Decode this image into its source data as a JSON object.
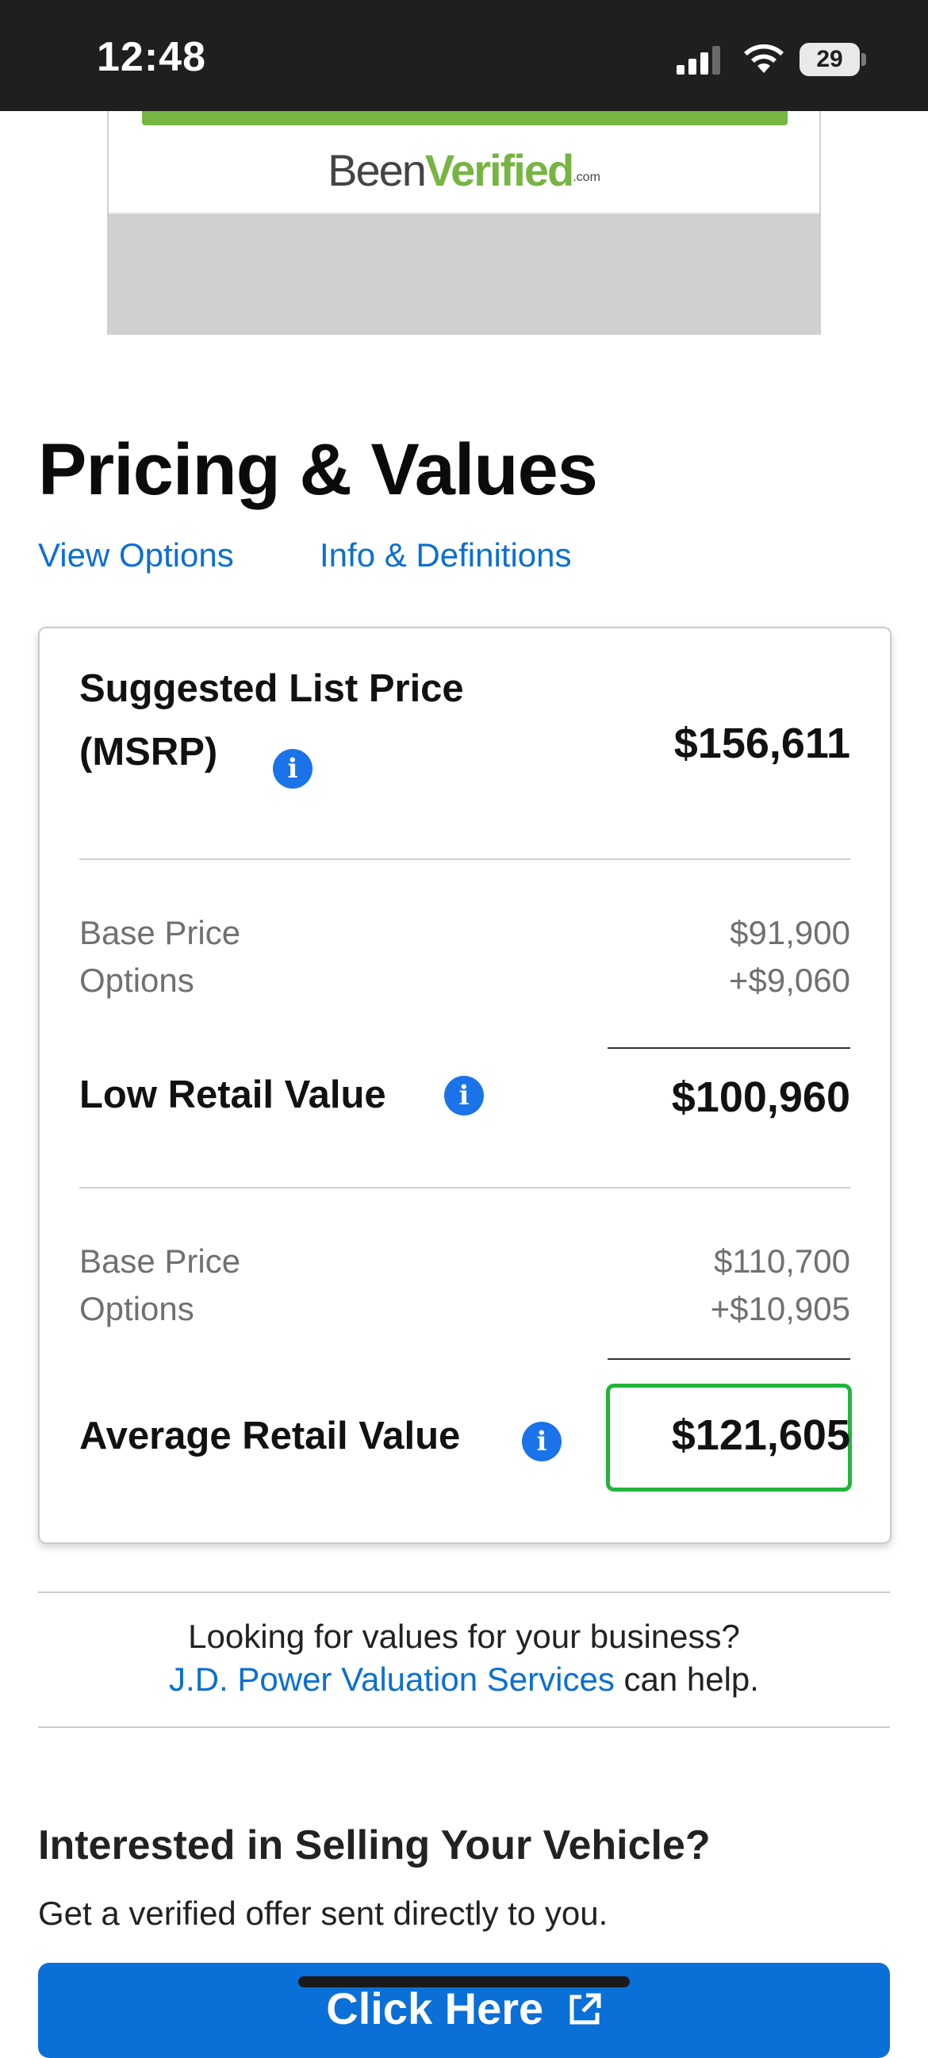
{
  "status_bar": {
    "time": "12:48",
    "battery": "29",
    "icons": [
      "signal-icon",
      "wifi-icon",
      "battery-icon"
    ]
  },
  "ad": {
    "logo_part1": "Been",
    "logo_part2": "Verified",
    "logo_suffix": ".com",
    "colors": {
      "green": "#77b543",
      "text": "#444444"
    }
  },
  "header": {
    "title": "Pricing & Values",
    "links": [
      "View Options",
      "Info & Definitions"
    ]
  },
  "pricing": {
    "msrp": {
      "title_line1": "Suggested List Price",
      "title_line2": "(MSRP)",
      "value": "$156,611"
    },
    "low_retail": {
      "base_label": "Base Price",
      "options_label": "Options",
      "base_value": "$91,900",
      "options_value": "+$9,060",
      "title": "Low Retail Value",
      "value": "$100,960"
    },
    "average_retail": {
      "base_label": "Base Price",
      "options_label": "Options",
      "base_value": "$110,700",
      "options_value": "+$10,905",
      "title": "Average Retail Value",
      "value": "$121,605"
    },
    "info_glyph": "i",
    "colors": {
      "info": "#1a73e8",
      "highlight": "#22b43c"
    }
  },
  "business": {
    "line1": "Looking for values for your business?",
    "link": "J.D. Power Valuation Services",
    "after_link": " can help.",
    "link_color": "#0a6fd6"
  },
  "selling": {
    "title": "Interested in Selling Your Vehicle?",
    "subtitle": "Get a verified offer sent directly to you.",
    "button_label": "Click Here",
    "button_color": "#0a6fd6"
  }
}
